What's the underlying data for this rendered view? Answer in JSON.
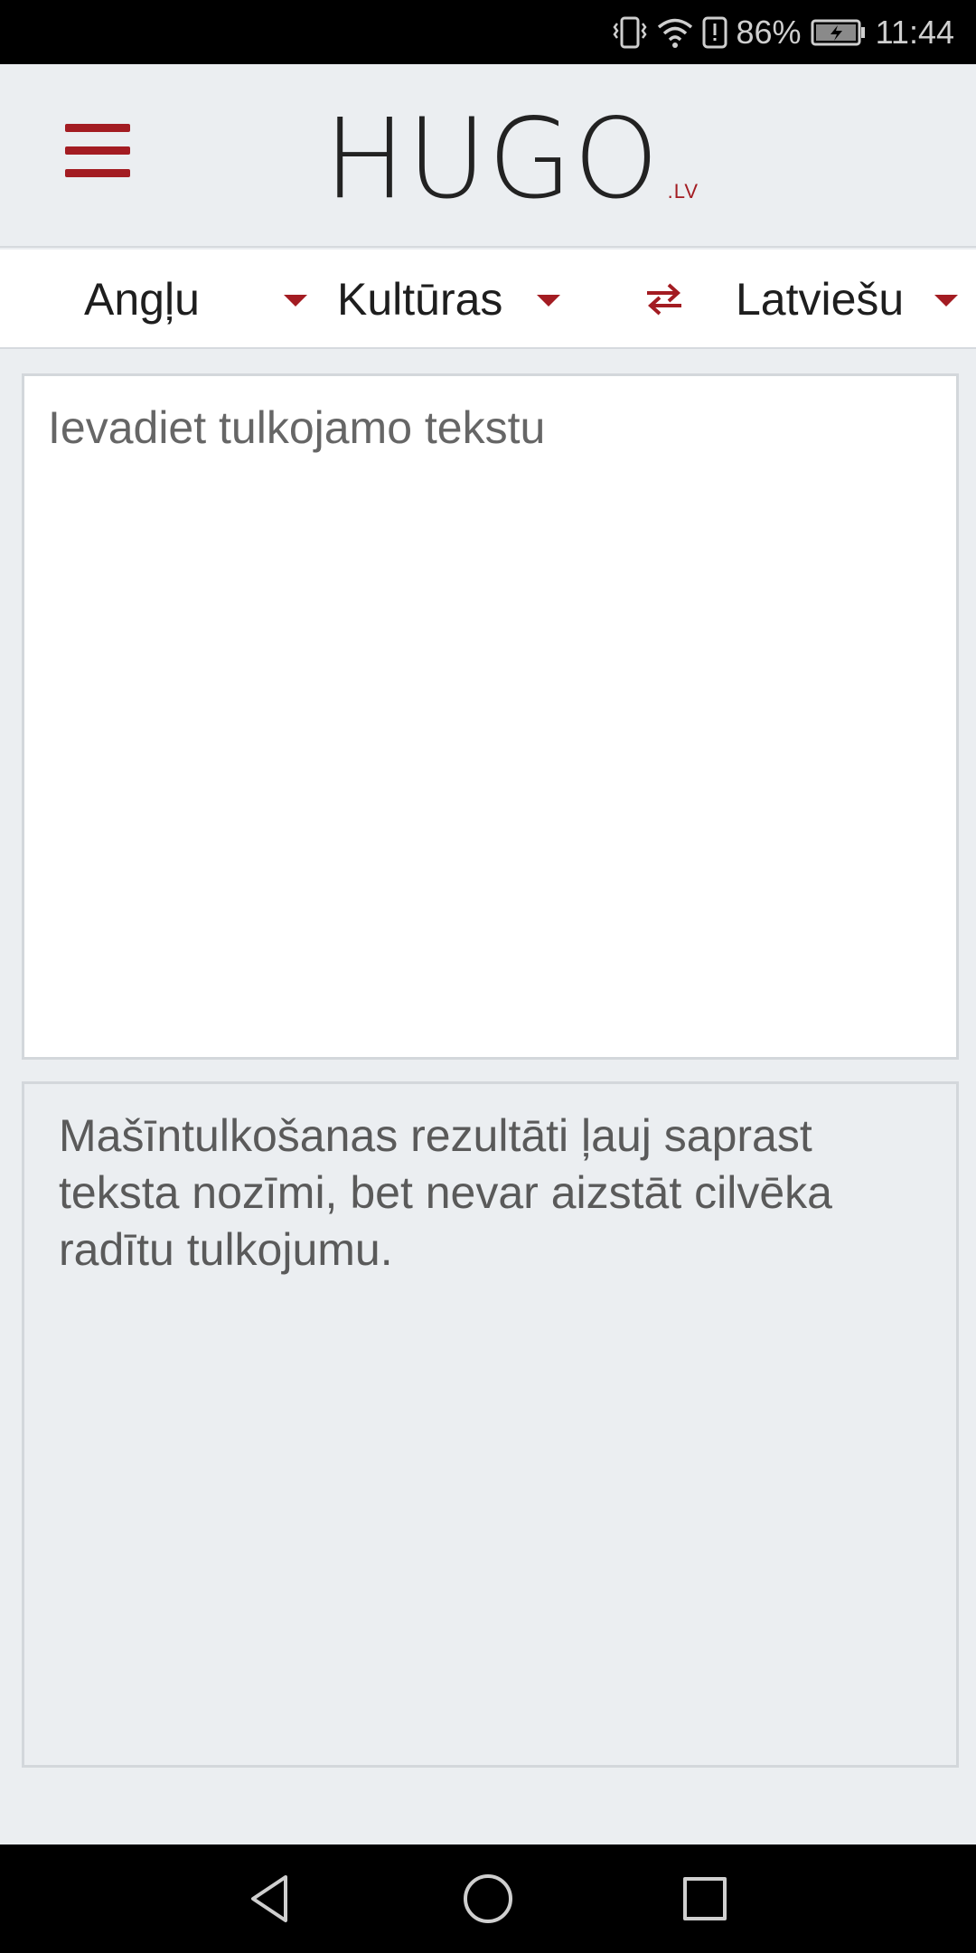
{
  "status_bar": {
    "battery_percent": "86%",
    "time": "11:44"
  },
  "header": {
    "logo_text": "HUGO",
    "logo_suffix": ".LV",
    "accent_color": "#a31c22"
  },
  "language_bar": {
    "source_language": "Angļu",
    "domain": "Kultūras",
    "target_language": "Latviešu"
  },
  "input": {
    "value": "",
    "placeholder": "Ievadiet tulkojamo tekstu"
  },
  "output": {
    "text": "Mašīntulkošanas rezultāti ļauj saprast teksta nozīmi, bet nevar aizstāt cilvēka radītu tulkojumu."
  },
  "icons": {
    "menu": "hamburger-icon",
    "swap": "swap-arrows-icon",
    "back": "back-triangle-icon",
    "home": "home-circle-icon",
    "recents": "recents-square-icon"
  }
}
